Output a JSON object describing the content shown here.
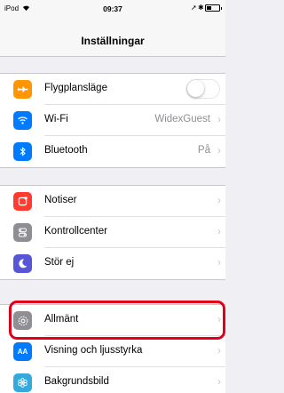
{
  "status_bar": {
    "carrier": "iPod",
    "time": "09:37"
  },
  "nav": {
    "title": "Inställningar"
  },
  "groups": [
    [
      {
        "label": "Flygplansläge",
        "icon": "airplane-icon",
        "color": "#ff9500",
        "control": "toggle",
        "toggle_on": false
      },
      {
        "label": "Wi-Fi",
        "icon": "wifi-icon",
        "color": "#007aff",
        "value": "WidexGuest"
      },
      {
        "label": "Bluetooth",
        "icon": "bluetooth-icon",
        "color": "#007aff",
        "value": "På"
      }
    ],
    [
      {
        "label": "Notiser",
        "icon": "notifications-icon",
        "color": "#ff3b30"
      },
      {
        "label": "Kontrollcenter",
        "icon": "control-center-icon",
        "color": "#8e8e93"
      },
      {
        "label": "Stör ej",
        "icon": "moon-icon",
        "color": "#5856d6"
      }
    ],
    [
      {
        "label": "Allmänt",
        "icon": "gear-icon",
        "color": "#8e8e93",
        "highlighted": true
      },
      {
        "label": "Visning och ljusstyrka",
        "icon": "display-brightness-icon",
        "color": "#007aff",
        "icon_text": "AA"
      },
      {
        "label": "Bakgrundsbild",
        "icon": "wallpaper-icon",
        "color": "#34aadc"
      }
    ]
  ],
  "highlight_color": "#e1001a"
}
